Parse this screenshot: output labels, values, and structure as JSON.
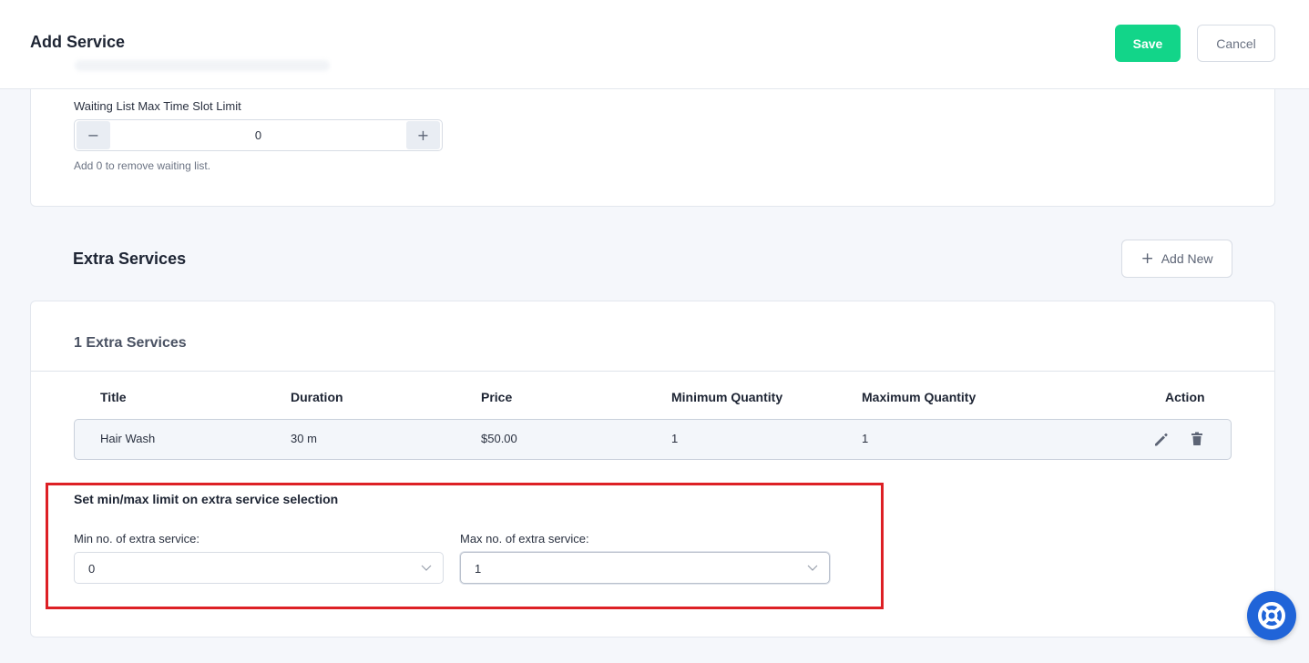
{
  "header": {
    "title": "Add Service",
    "save_label": "Save",
    "cancel_label": "Cancel"
  },
  "waiting_list": {
    "label": "Waiting List Max Time Slot Limit",
    "value": "0",
    "minus": "−",
    "plus": "+",
    "help": "Add 0 to remove waiting list."
  },
  "extra_services": {
    "heading": "Extra Services",
    "add_new_label": "Add New",
    "count_title": "1 Extra Services",
    "columns": [
      "Title",
      "Duration",
      "Price",
      "Minimum Quantity",
      "Maximum Quantity",
      "Action"
    ],
    "rows": [
      {
        "title": "Hair Wash",
        "duration": "30 m",
        "price": "$50.00",
        "min_qty": "1",
        "max_qty": "1"
      }
    ]
  },
  "limit": {
    "title": "Set min/max limit on extra service selection",
    "min_label": "Min no. of extra service:",
    "min_value": "0",
    "max_label": "Max no. of extra service:",
    "max_value": "1"
  },
  "icons": {
    "edit": "pencil-icon",
    "delete": "trash-icon",
    "add": "plus-icon",
    "help": "lifebuoy-icon",
    "dropdown": "chevron-down-icon"
  },
  "colors": {
    "save": "#12d589",
    "highlight": "#dd2025",
    "help_fab": "#2064d8"
  }
}
